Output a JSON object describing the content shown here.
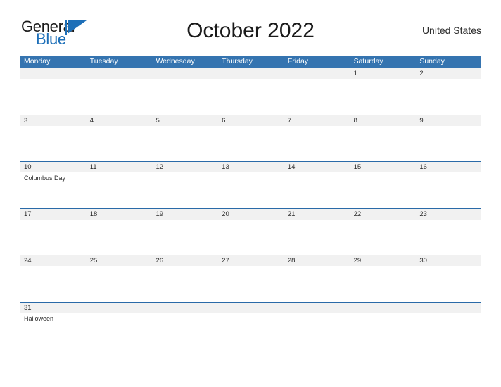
{
  "logo": {
    "word_one": "General",
    "word_two": "Blue",
    "triangle_icon": "triangle-icon",
    "word_one_color": "#1a1a1a",
    "word_two_color": "#1d6fb8",
    "triangle_color": "#1d6fb8"
  },
  "header": {
    "title": "October 2022",
    "region": "United States"
  },
  "theme": {
    "header_blue": "#3574b0",
    "row_line_blue": "#2a6aa8",
    "date_band_gray": "#f1f1f1",
    "page_background": "#ffffff",
    "text_color": "#2b2b2b"
  },
  "calendar": {
    "weekdays": [
      "Monday",
      "Tuesday",
      "Wednesday",
      "Thursday",
      "Friday",
      "Saturday",
      "Sunday"
    ],
    "weeks": [
      {
        "dates": [
          "",
          "",
          "",
          "",
          "",
          "1",
          "2"
        ],
        "events": [
          "",
          "",
          "",
          "",
          "",
          "",
          ""
        ]
      },
      {
        "dates": [
          "3",
          "4",
          "5",
          "6",
          "7",
          "8",
          "9"
        ],
        "events": [
          "",
          "",
          "",
          "",
          "",
          "",
          ""
        ]
      },
      {
        "dates": [
          "10",
          "11",
          "12",
          "13",
          "14",
          "15",
          "16"
        ],
        "events": [
          "Columbus Day",
          "",
          "",
          "",
          "",
          "",
          ""
        ]
      },
      {
        "dates": [
          "17",
          "18",
          "19",
          "20",
          "21",
          "22",
          "23"
        ],
        "events": [
          "",
          "",
          "",
          "",
          "",
          "",
          ""
        ]
      },
      {
        "dates": [
          "24",
          "25",
          "26",
          "27",
          "28",
          "29",
          "30"
        ],
        "events": [
          "",
          "",
          "",
          "",
          "",
          "",
          ""
        ]
      },
      {
        "dates": [
          "31",
          "",
          "",
          "",
          "",
          "",
          ""
        ],
        "events": [
          "Halloween",
          "",
          "",
          "",
          "",
          "",
          ""
        ]
      }
    ]
  }
}
